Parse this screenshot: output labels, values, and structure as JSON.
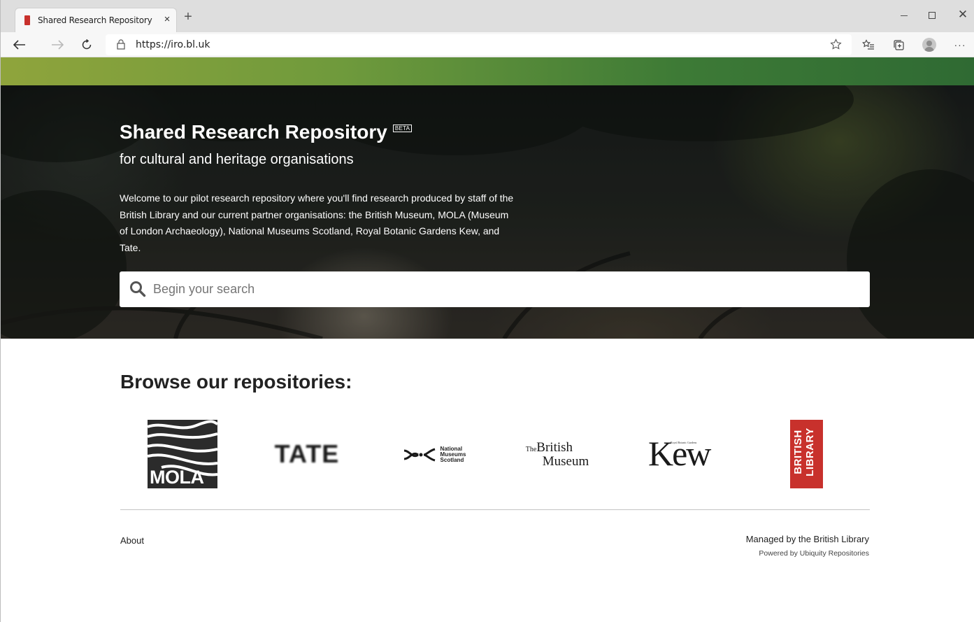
{
  "browser": {
    "tab_title": "Shared Research Repository",
    "tab_close": "×",
    "new_tab": "+",
    "url": "https://iro.bl.uk",
    "window_close": "✕",
    "more": "···"
  },
  "hero": {
    "title": "Shared Research Repository",
    "badge": "BETA",
    "subtitle": "for cultural and heritage organisations",
    "description": "Welcome to our pilot research repository where you'll find research produced by staff of the British Library and our current partner organisations: the British Museum, MOLA (Museum of London Archaeology), National Museums Scotland, Royal Botanic Gardens Kew, and Tate.",
    "search_placeholder": "Begin your search"
  },
  "browse": {
    "title": "Browse our repositories:",
    "logos": {
      "mola": "MOLA",
      "tate": "TATE",
      "nms_line1": "National",
      "nms_line2": "Museums",
      "nms_line3": "Scotland",
      "bm_the": "The",
      "bm_line1": "British",
      "bm_line2": "Museum",
      "kew": "Kew",
      "kew_small": "Royal Botanic Gardens",
      "bl_line1": "BRITISH",
      "bl_line2": "LIBRARY"
    }
  },
  "footer": {
    "about": "About",
    "managed": "Managed by the British Library",
    "powered": "Powered by Ubiquity Repositories"
  },
  "colors": {
    "bl_red": "#c8312c",
    "green_bar": "#4f8a38"
  }
}
